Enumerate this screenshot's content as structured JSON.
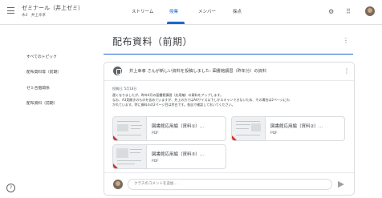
{
  "header": {
    "class_title": "ゼミナール（井上ゼミ）",
    "class_sub": "木4　井上幸孝",
    "tabs": [
      "ストリーム",
      "授業",
      "メンバー",
      "採点"
    ],
    "active_tab": "授業",
    "icons": [
      "menu-icon",
      "settings-icon",
      "apps-icon",
      "avatar"
    ]
  },
  "sidebar": {
    "items": [
      "すべてのトピック",
      "配布資料等（前期）",
      "ゼミ合宿関係",
      "配布資料（前期）"
    ]
  },
  "topic": {
    "title": "配布資料（前期）"
  },
  "card": {
    "title": "井上幸孝 さんが新しい資料を投稿しました: 図書館講習（昨年分）の資料",
    "posted": "投稿日: 5月18日",
    "body": [
      "遅くなりましたが、昨年4月の図書館講習（応用編）の資料をアップします。",
      "なお、A3見開きのものを含めていますが、井上の方ではA4サイズ以下しかスキャンできないため、その場合は2ページにわ",
      "かれています。特に資料③の2ページ目は余白です。各自で確認しておいてください。"
    ],
    "attachments": [
      {
        "title": "図書館応用編（資料①）...",
        "type": "PDF"
      },
      {
        "title": "図書館応用編（資料②）...",
        "type": "PDF"
      },
      {
        "title": "図書館応用編（資料③）...",
        "type": "PDF"
      }
    ],
    "comment_placeholder": "クラスのコメントを追加..."
  },
  "colors": {
    "accent": "#1967d2",
    "pdf": "#d93025"
  }
}
